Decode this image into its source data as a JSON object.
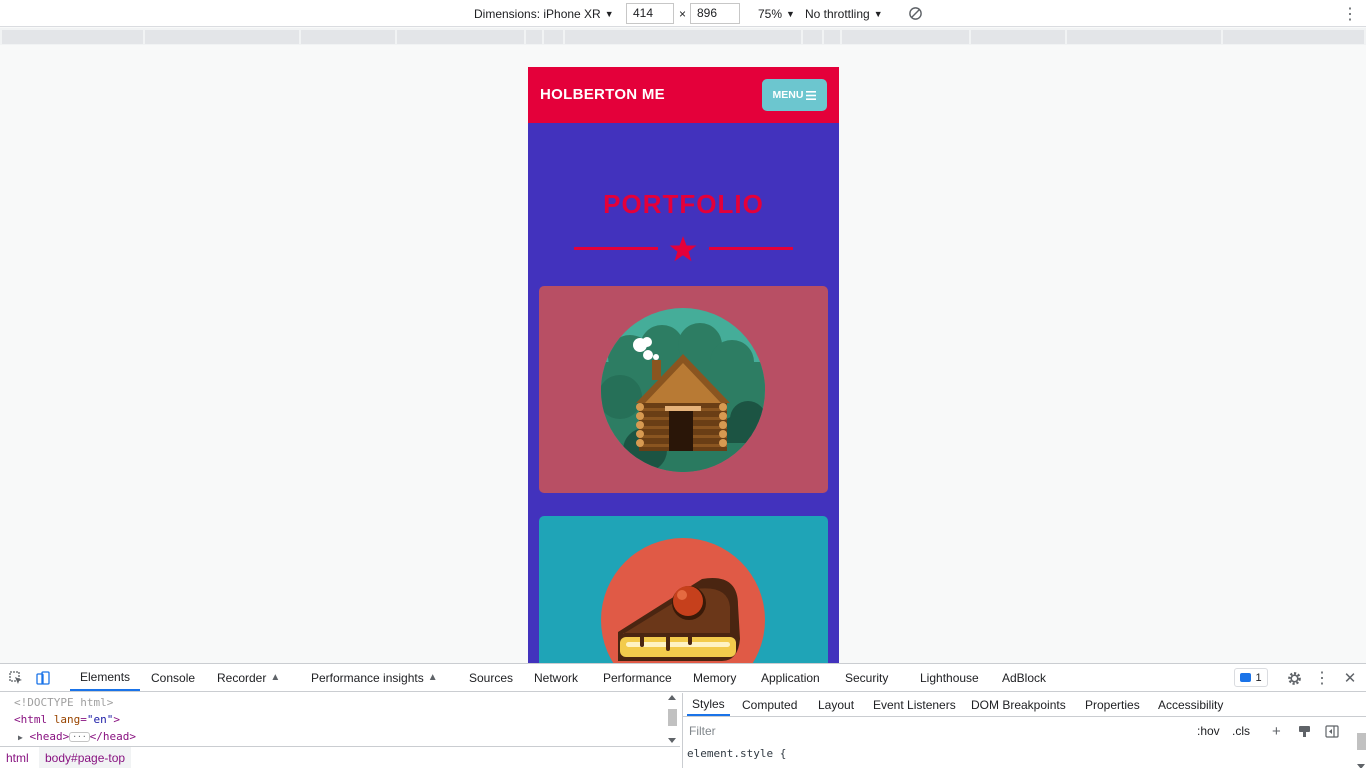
{
  "device_toolbar": {
    "dimensions_label": "Dimensions: iPhone XR",
    "width": "414",
    "times": "×",
    "height": "896",
    "zoom": "75%",
    "throttling": "No throttling"
  },
  "page": {
    "brand": "HOLBERTON ME",
    "menu_label": "MENU",
    "section_title": "PORTFOLIO"
  },
  "devtools": {
    "tabs": [
      "Elements",
      "Console",
      "Recorder",
      "Performance insights",
      "Sources",
      "Network",
      "Performance",
      "Memory",
      "Application",
      "Security",
      "Lighthouse",
      "AdBlock"
    ],
    "issues_count": "1",
    "dom": {
      "doctype": "<!DOCTYPE html>",
      "html_tag": "html",
      "html_attr_name": "lang",
      "html_attr_value": "\"en\"",
      "head_open": "<head>",
      "head_close": "</head>"
    },
    "breadcrumbs": [
      "html",
      "body#page-top"
    ],
    "sub_tabs": [
      "Styles",
      "Computed",
      "Layout",
      "Event Listeners",
      "DOM Breakpoints",
      "Properties",
      "Accessibility"
    ],
    "filter_placeholder": "Filter",
    "hov": ":hov",
    "cls": ".cls",
    "element_style": "element.style {"
  },
  "colors": {
    "navbar": "#e4003a",
    "page_bg": "#4232bd",
    "menu_button": "#6cc6cf",
    "card_1": "#b84f64",
    "card_2": "#1fa4b7",
    "accent": "#1a73e8"
  },
  "icons": [
    "inspect-icon",
    "device-toolbar-icon",
    "rotate-icon",
    "more-options-icon",
    "hamburger-icon",
    "star-icon",
    "settings-icon",
    "close-icon",
    "new-style-rule-icon",
    "computed-toggle-icon",
    "sidebar-toggle-icon"
  ]
}
